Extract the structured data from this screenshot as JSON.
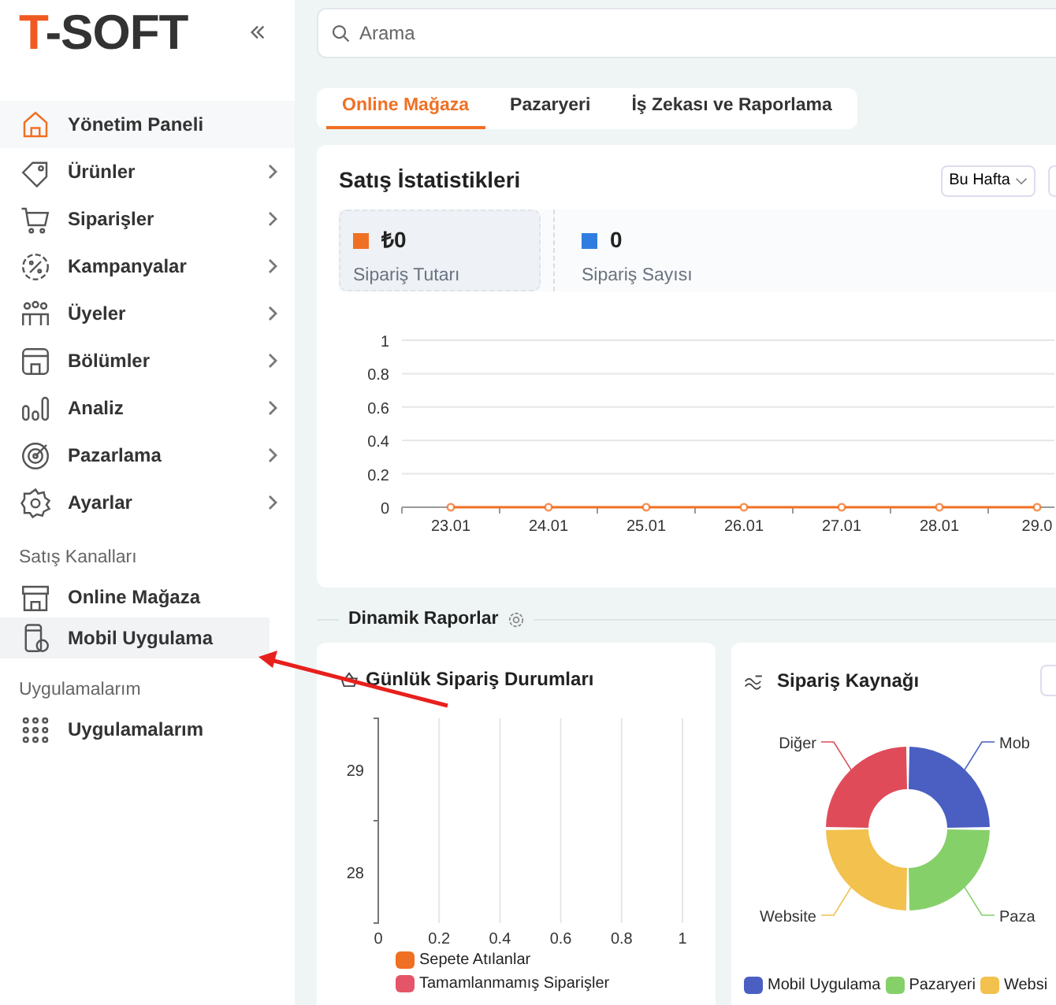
{
  "sidebar": {
    "logo": {
      "accent": "T",
      "rest": "-SOFT"
    },
    "menu": [
      {
        "kind": "home",
        "label": "Yönetim Paneli",
        "selected": true,
        "submenu": false
      },
      {
        "kind": "tag",
        "label": "Ürünler",
        "selected": false,
        "submenu": true
      },
      {
        "kind": "cart",
        "label": "Siparişler",
        "selected": false,
        "submenu": true
      },
      {
        "kind": "percent",
        "label": "Kampanyalar",
        "selected": false,
        "submenu": true
      },
      {
        "kind": "users",
        "label": "Üyeler",
        "selected": false,
        "submenu": true
      },
      {
        "kind": "layout",
        "label": "Bölümler",
        "selected": false,
        "submenu": true
      },
      {
        "kind": "chart",
        "label": "Analiz",
        "selected": false,
        "submenu": true
      },
      {
        "kind": "target",
        "label": "Pazarlama",
        "selected": false,
        "submenu": true
      },
      {
        "kind": "gear",
        "label": "Ayarlar",
        "selected": false,
        "submenu": true
      }
    ],
    "sections": [
      {
        "title": "Satış Kanalları",
        "items": [
          {
            "kind": "store",
            "label": "Online Mağaza",
            "hovered": false
          },
          {
            "kind": "mobile",
            "label": "Mobil Uygulama",
            "hovered": true
          }
        ]
      },
      {
        "title": "Uygulamalarım",
        "items": [
          {
            "kind": "apps",
            "label": "Uygulamalarım",
            "hovered": false
          }
        ]
      }
    ]
  },
  "search": {
    "placeholder": "Arama"
  },
  "tabs": [
    {
      "label": "Online Mağaza",
      "selected": true
    },
    {
      "label": "Pazaryeri",
      "selected": false
    },
    {
      "label": "İş Zekası ve Raporlama",
      "selected": false
    }
  ],
  "sales_stats": {
    "title": "Satış İstatistikleri",
    "period": "Bu Hafta",
    "metrics": [
      {
        "value": "₺0",
        "label": "Sipariş Tutarı",
        "color": "#f07023",
        "selected": true
      },
      {
        "value": "0",
        "label": "Sipariş Sayısı",
        "color": "#2f7de1",
        "selected": false
      }
    ],
    "chart_data": {
      "type": "line",
      "grid": true,
      "categories": [
        "23.01",
        "24.01",
        "25.01",
        "26.01",
        "27.01",
        "28.01",
        "29.0"
      ],
      "ylim": [
        0,
        1
      ],
      "yticks": [
        0,
        0.2,
        0.4,
        0.6,
        0.8,
        1
      ],
      "series": [
        {
          "color": "#f07023",
          "marker": "circle",
          "values": [
            0,
            0,
            0,
            0,
            0,
            0,
            0
          ]
        }
      ]
    }
  },
  "dynamic_reports": {
    "title": "Dinamik Raporlar",
    "daily": {
      "title": "Günlük Sipariş Durumları",
      "chart_data": {
        "type": "bar",
        "orientation": "horizontal",
        "grid": true,
        "categories": [
          "29",
          "28"
        ],
        "xlim": [
          0,
          1
        ],
        "xticks": [
          0,
          0.2,
          0.4,
          0.6,
          0.8,
          1
        ],
        "series": [
          {
            "name": "Sepete Atılanlar",
            "color": "#f07023",
            "values": [
              0,
              0
            ]
          },
          {
            "name": "Tamamlanmamış Siparişler",
            "color": "#e5556a",
            "values": [
              0,
              0
            ]
          }
        ]
      }
    },
    "source": {
      "title": "Sipariş Kaynağı",
      "chart_data": {
        "type": "donut",
        "categories": [
          "Mob",
          "Paza",
          "Website",
          "Diğer"
        ],
        "values": [
          25,
          25,
          25,
          25
        ],
        "colors": [
          "#4a5fc1",
          "#86d06a",
          "#f2c14e",
          "#e04b5a"
        ]
      },
      "legend": [
        {
          "label": "Mobil Uygulama",
          "color": "#4a5fc1"
        },
        {
          "label": "Pazaryeri",
          "color": "#86d06a"
        },
        {
          "label": "Websi",
          "color": "#f2c14e"
        }
      ]
    }
  }
}
